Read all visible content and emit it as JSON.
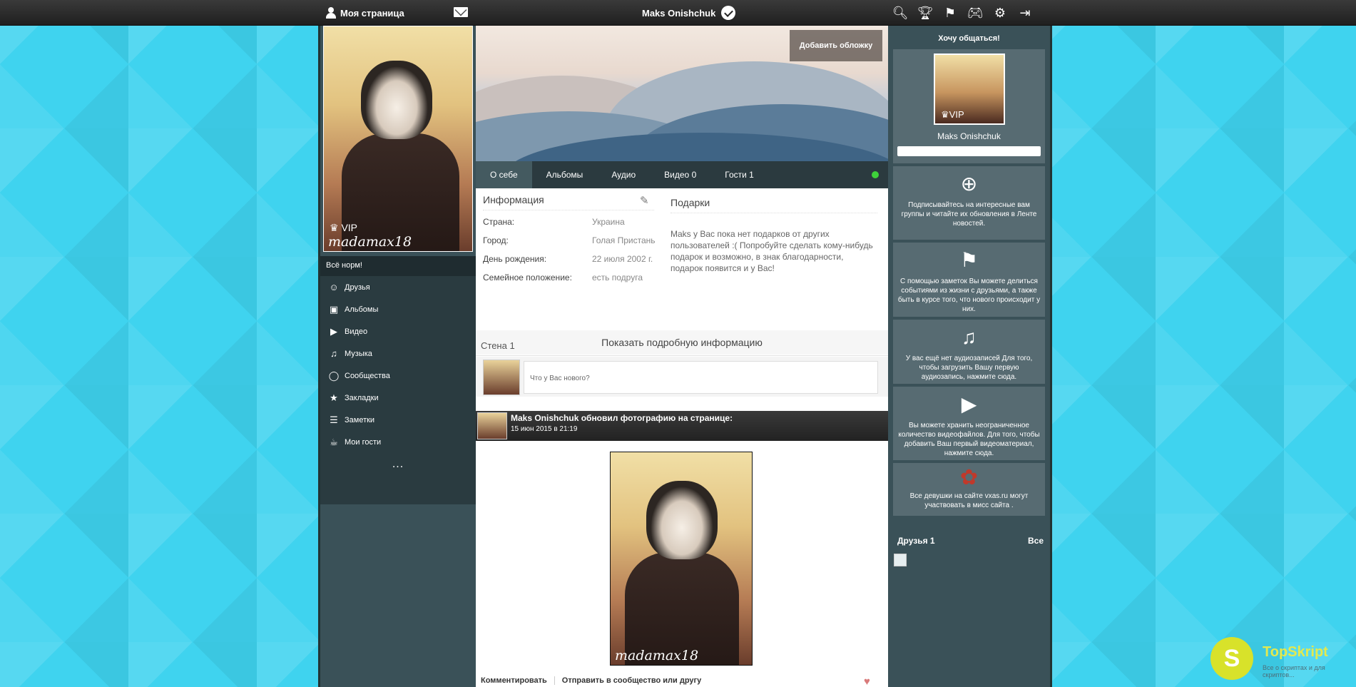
{
  "topbar": {
    "my_page": "Моя страница",
    "user_name": "Maks Onishchuk",
    "icons": [
      "search-icon",
      "trophy-icon",
      "flag-icon",
      "gamepad-icon",
      "gear-icon",
      "exit-icon"
    ]
  },
  "left": {
    "vip": "VIP",
    "signature": "madamax18",
    "status": "Всё норм!",
    "nav": [
      {
        "label": "Друзья",
        "icon": "friends-icon"
      },
      {
        "label": "Альбомы",
        "icon": "albums-icon"
      },
      {
        "label": "Видео",
        "icon": "video-icon"
      },
      {
        "label": "Музыка",
        "icon": "music-icon"
      },
      {
        "label": "Сообщества",
        "icon": "communities-icon"
      },
      {
        "label": "Закладки",
        "icon": "bookmarks-icon"
      },
      {
        "label": "Заметки",
        "icon": "notes-icon"
      },
      {
        "label": "Мои гости",
        "icon": "guests-icon"
      }
    ],
    "more": "..."
  },
  "center": {
    "add_cover": "Добавить обложку",
    "tabs": [
      "О себе",
      "Альбомы",
      "Аудио",
      "Видео 0",
      "Гости 1"
    ],
    "info": {
      "title": "Информация",
      "rows": [
        {
          "label": "Страна:",
          "value": "Украина"
        },
        {
          "label": "Город:",
          "value": "Голая Пристань"
        },
        {
          "label": "День рождения:",
          "value": "22 июля 2002 г."
        },
        {
          "label": "Семейное положение:",
          "value": "есть подруга"
        }
      ]
    },
    "gifts": {
      "title": "Подарки",
      "text": "Maks у Вас пока нет подарков от других пользователей :( Попробуйте сделать кому-нибудь подарок и возможно, в знак благодарности, подарок появится и у Вас!"
    },
    "show_more": "Показать подробную информацию",
    "wall_title": "Стена 1",
    "post_placeholder": "Что у Вас нового?",
    "feed": {
      "title": "Maks Onishchuk обновил фотографию на странице:",
      "date": "15 июн 2015 в 21:19",
      "photo_signature": "madamax18",
      "comment": "Комментировать",
      "share": "Отправить в сообщество или другу"
    }
  },
  "right": {
    "title": "Хочу общаться!",
    "vip": "VIP",
    "name": "Maks Onishchuk",
    "tips": [
      {
        "icon": "add-chat-icon",
        "text": "Подписывайтесь на интересные вам группы и читайте их обновления в Ленте новостей."
      },
      {
        "icon": "flag-note-icon",
        "text": "С помощью заметок Вы можете делиться событиями из жизни с друзьями, а также быть в курсе того, что нового происходит у них."
      },
      {
        "icon": "music-note-icon",
        "text": "У вас ещё нет аудиозаписей Для того, чтобы загрузить Вашу первую аудиозапись, нажмите сюда."
      },
      {
        "icon": "film-icon",
        "text": "Вы можете хранить неограниченное количество видеофайлов. Для того, чтобы добавить Ваш первый видеоматериал, нажмите сюда."
      },
      {
        "icon": "roses-icon",
        "text": "Все девушки на сайте vxas.ru могут участвовать в мисс сайта ."
      }
    ],
    "friends_title": "Друзья 1",
    "friends_all": "Все"
  },
  "watermark": {
    "logo": "S",
    "name": "TopSkript",
    "sub": "Все о скриптах и для скриптов..."
  },
  "colors": {
    "background": "#3fd3ef",
    "column": "#3a5158",
    "topbar": "#2b2b2b",
    "online": "#3ed23a"
  }
}
